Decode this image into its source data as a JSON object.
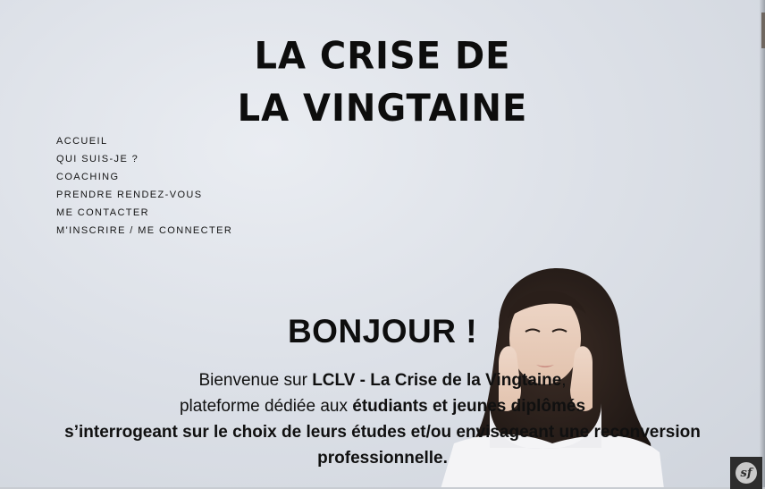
{
  "site": {
    "title_line1": "LA CRISE DE",
    "title_line2": "LA VINGTAINE"
  },
  "nav": {
    "items": [
      {
        "label": "ACCUEIL"
      },
      {
        "label": "QUI SUIS-JE ?"
      },
      {
        "label": "COACHING"
      },
      {
        "label": "PRENDRE RENDEZ-VOUS"
      },
      {
        "label": "ME CONTACTER"
      },
      {
        "label": "M'INSCRIRE / ME CONNECTER"
      }
    ]
  },
  "hero": {
    "heading": "BONJOUR !",
    "line1_prefix": "Bienvenue sur ",
    "line1_bold": "LCLV - La Crise de la Vingtaine",
    "line1_suffix": ",",
    "line2_prefix": "plateforme dédiée aux ",
    "line2_bold": "étudiants et jeunes diplômés",
    "line3_bold": "s’interrogeant sur le choix de leurs études et/ou envisageant une reconversion professionnelle."
  },
  "debug_toolbar": {
    "icon": "symfony-icon",
    "glyph": "sf"
  },
  "colors": {
    "background": "#dde1e8",
    "text": "#111111",
    "toolbar": "#2d2d2d"
  }
}
